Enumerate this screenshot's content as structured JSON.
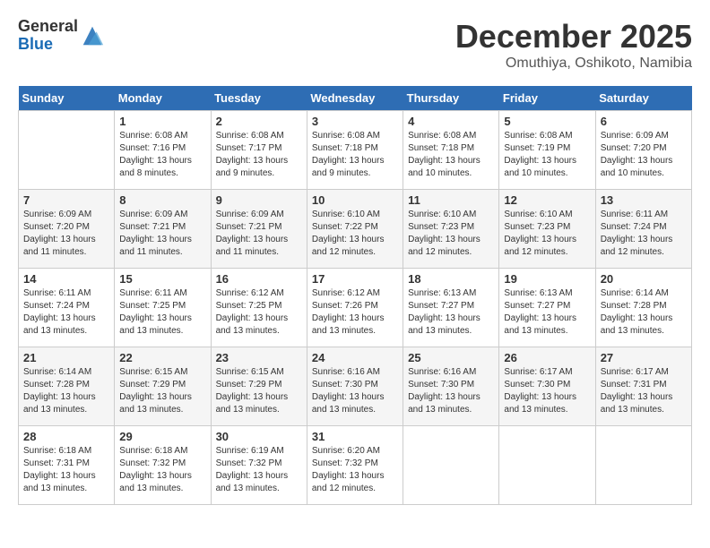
{
  "header": {
    "logo_line1": "General",
    "logo_line2": "Blue",
    "month": "December 2025",
    "location": "Omuthiya, Oshikoto, Namibia"
  },
  "days_of_week": [
    "Sunday",
    "Monday",
    "Tuesday",
    "Wednesday",
    "Thursday",
    "Friday",
    "Saturday"
  ],
  "weeks": [
    [
      {
        "day": "",
        "empty": true
      },
      {
        "day": "1",
        "sunrise": "6:08 AM",
        "sunset": "7:16 PM",
        "daylight": "13 hours and 8 minutes."
      },
      {
        "day": "2",
        "sunrise": "6:08 AM",
        "sunset": "7:17 PM",
        "daylight": "13 hours and 9 minutes."
      },
      {
        "day": "3",
        "sunrise": "6:08 AM",
        "sunset": "7:18 PM",
        "daylight": "13 hours and 9 minutes."
      },
      {
        "day": "4",
        "sunrise": "6:08 AM",
        "sunset": "7:18 PM",
        "daylight": "13 hours and 10 minutes."
      },
      {
        "day": "5",
        "sunrise": "6:08 AM",
        "sunset": "7:19 PM",
        "daylight": "13 hours and 10 minutes."
      },
      {
        "day": "6",
        "sunrise": "6:09 AM",
        "sunset": "7:20 PM",
        "daylight": "13 hours and 10 minutes."
      }
    ],
    [
      {
        "day": "7",
        "sunrise": "6:09 AM",
        "sunset": "7:20 PM",
        "daylight": "13 hours and 11 minutes."
      },
      {
        "day": "8",
        "sunrise": "6:09 AM",
        "sunset": "7:21 PM",
        "daylight": "13 hours and 11 minutes."
      },
      {
        "day": "9",
        "sunrise": "6:09 AM",
        "sunset": "7:21 PM",
        "daylight": "13 hours and 11 minutes."
      },
      {
        "day": "10",
        "sunrise": "6:10 AM",
        "sunset": "7:22 PM",
        "daylight": "13 hours and 12 minutes."
      },
      {
        "day": "11",
        "sunrise": "6:10 AM",
        "sunset": "7:23 PM",
        "daylight": "13 hours and 12 minutes."
      },
      {
        "day": "12",
        "sunrise": "6:10 AM",
        "sunset": "7:23 PM",
        "daylight": "13 hours and 12 minutes."
      },
      {
        "day": "13",
        "sunrise": "6:11 AM",
        "sunset": "7:24 PM",
        "daylight": "13 hours and 12 minutes."
      }
    ],
    [
      {
        "day": "14",
        "sunrise": "6:11 AM",
        "sunset": "7:24 PM",
        "daylight": "13 hours and 13 minutes."
      },
      {
        "day": "15",
        "sunrise": "6:11 AM",
        "sunset": "7:25 PM",
        "daylight": "13 hours and 13 minutes."
      },
      {
        "day": "16",
        "sunrise": "6:12 AM",
        "sunset": "7:25 PM",
        "daylight": "13 hours and 13 minutes."
      },
      {
        "day": "17",
        "sunrise": "6:12 AM",
        "sunset": "7:26 PM",
        "daylight": "13 hours and 13 minutes."
      },
      {
        "day": "18",
        "sunrise": "6:13 AM",
        "sunset": "7:27 PM",
        "daylight": "13 hours and 13 minutes."
      },
      {
        "day": "19",
        "sunrise": "6:13 AM",
        "sunset": "7:27 PM",
        "daylight": "13 hours and 13 minutes."
      },
      {
        "day": "20",
        "sunrise": "6:14 AM",
        "sunset": "7:28 PM",
        "daylight": "13 hours and 13 minutes."
      }
    ],
    [
      {
        "day": "21",
        "sunrise": "6:14 AM",
        "sunset": "7:28 PM",
        "daylight": "13 hours and 13 minutes."
      },
      {
        "day": "22",
        "sunrise": "6:15 AM",
        "sunset": "7:29 PM",
        "daylight": "13 hours and 13 minutes."
      },
      {
        "day": "23",
        "sunrise": "6:15 AM",
        "sunset": "7:29 PM",
        "daylight": "13 hours and 13 minutes."
      },
      {
        "day": "24",
        "sunrise": "6:16 AM",
        "sunset": "7:30 PM",
        "daylight": "13 hours and 13 minutes."
      },
      {
        "day": "25",
        "sunrise": "6:16 AM",
        "sunset": "7:30 PM",
        "daylight": "13 hours and 13 minutes."
      },
      {
        "day": "26",
        "sunrise": "6:17 AM",
        "sunset": "7:30 PM",
        "daylight": "13 hours and 13 minutes."
      },
      {
        "day": "27",
        "sunrise": "6:17 AM",
        "sunset": "7:31 PM",
        "daylight": "13 hours and 13 minutes."
      }
    ],
    [
      {
        "day": "28",
        "sunrise": "6:18 AM",
        "sunset": "7:31 PM",
        "daylight": "13 hours and 13 minutes."
      },
      {
        "day": "29",
        "sunrise": "6:18 AM",
        "sunset": "7:32 PM",
        "daylight": "13 hours and 13 minutes."
      },
      {
        "day": "30",
        "sunrise": "6:19 AM",
        "sunset": "7:32 PM",
        "daylight": "13 hours and 13 minutes."
      },
      {
        "day": "31",
        "sunrise": "6:20 AM",
        "sunset": "7:32 PM",
        "daylight": "13 hours and 12 minutes."
      },
      {
        "day": "",
        "empty": true
      },
      {
        "day": "",
        "empty": true
      },
      {
        "day": "",
        "empty": true
      }
    ]
  ]
}
